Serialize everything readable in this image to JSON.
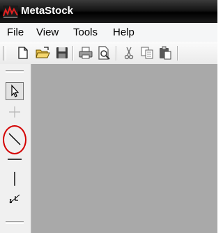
{
  "titlebar": {
    "title": "MetaStock",
    "icon": "metastock-app-icon"
  },
  "menu": {
    "file": "File",
    "view": "View",
    "tools": "Tools",
    "help": "Help"
  },
  "toolbar": {
    "icons": [
      "new-document-icon",
      "open-folder-icon",
      "save-icon",
      "print-icon",
      "print-preview-icon",
      "cut-icon",
      "copy-icon",
      "paste-icon"
    ]
  },
  "drawing_tools": {
    "items": [
      "pointer-icon",
      "crosshair-icon",
      "trendline-icon",
      "horizontal-line-icon",
      "vertical-line-icon",
      "text-annotation-icon"
    ],
    "selected": "pointer-icon",
    "highlighted": "trendline-icon",
    "highlight_color": "#d40000"
  },
  "colors": {
    "chart_background": "#a9a9a9",
    "title_bar": "#000000"
  }
}
